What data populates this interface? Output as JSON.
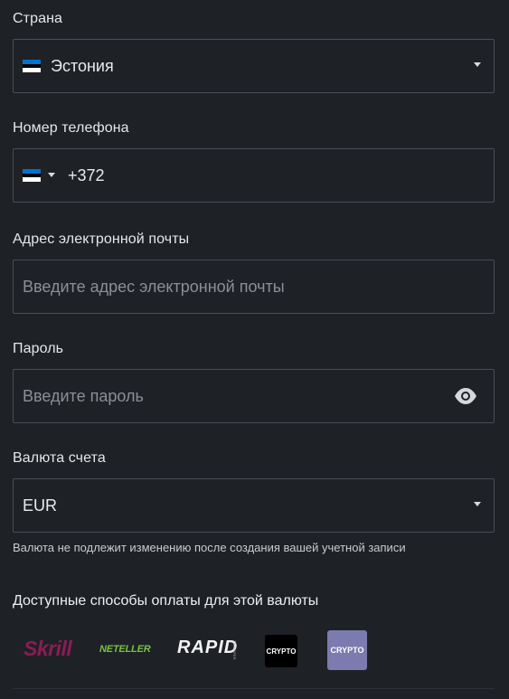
{
  "country": {
    "label": "Страна",
    "value": "Эстония",
    "flag": "estonia-flag"
  },
  "phone": {
    "label": "Номер телефона",
    "prefix": "+372",
    "flag": "estonia-flag"
  },
  "email": {
    "label": "Адрес электронной почты",
    "placeholder": "Введите адрес электронной почты"
  },
  "password": {
    "label": "Пароль",
    "placeholder": "Введите пароль",
    "toggle_icon": "eye-icon"
  },
  "currency": {
    "label": "Валюта счета",
    "value": "EUR",
    "hint": "Валюта не подлежит изменению после создания вашей учетной записи"
  },
  "payment": {
    "title": "Доступные способы оплаты для этой валюты",
    "methods": [
      "Skrill",
      "NETELLER",
      "RAPID",
      "CRYPTO",
      "CRYPTO"
    ],
    "rapid_sub": "TRANSFER"
  },
  "colors": {
    "background": "#1e2126",
    "border": "#4a4e55",
    "skrill": "#8a1c54",
    "neteller": "#79c143",
    "crypto_alt": "#7b7bb0"
  }
}
